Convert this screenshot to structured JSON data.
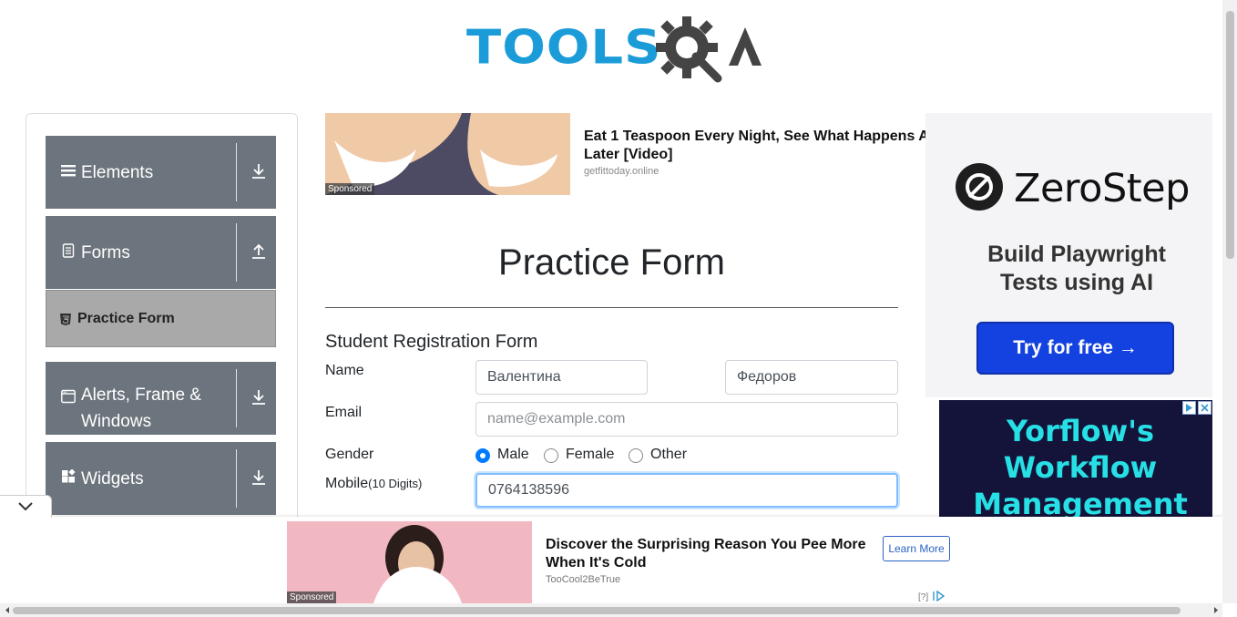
{
  "header": {
    "logo_text": "TOOLS",
    "logo_suffix": "QA"
  },
  "sidebar": {
    "groups": [
      {
        "label": "Elements",
        "icon": "hamburger-icon",
        "arrow": "download-icon"
      },
      {
        "label": "Forms",
        "icon": "document-icon",
        "arrow": "upload-icon"
      },
      {
        "label": "Alerts, Frame & Windows",
        "icon": "window-icon",
        "arrow": "download-icon"
      },
      {
        "label": "Widgets",
        "icon": "widgets-icon",
        "arrow": "download-icon"
      }
    ],
    "active_item": {
      "label": "Practice Form",
      "icon": "html5-icon"
    }
  },
  "ad_top": {
    "title": "Eat 1 Teaspoon Every Night, See What Happens A",
    "title_line2": "Later [Video]",
    "domain": "getfittoday.online",
    "sponsored": "Sponsored"
  },
  "main": {
    "title": "Practice Form",
    "form_title": "Student Registration Form"
  },
  "form": {
    "name_label": "Name",
    "first_name_value": "Валентина",
    "last_name_value": "Федоров",
    "email_label": "Email",
    "email_placeholder": "name@example.com",
    "gender_label": "Gender",
    "gender_options": [
      "Male",
      "Female",
      "Other"
    ],
    "gender_selected": "Male",
    "mobile_label": "Mobile",
    "mobile_hint": "(10 Digits)",
    "mobile_value": "0764138596"
  },
  "ad_right": {
    "brand": "ZeroStep",
    "tagline_1": "Build Playwright",
    "tagline_2": "Tests using AI",
    "cta": "Try for free →"
  },
  "ad_yorflow": {
    "line1": "Yorflow's",
    "line2": "Workflow",
    "line3": "Management"
  },
  "ad_bottom": {
    "title": "Discover the Surprising Reason You Pee More When It's Cold",
    "domain": "TooCool2BeTrue",
    "sponsored": "Sponsored",
    "cta": "Learn More",
    "info": "[?]"
  },
  "colors": {
    "logo_blue": "#1b9cd8",
    "logo_gray": "#444444",
    "sidebar_bg": "#6c757d",
    "active_item_bg": "#a9a9a9",
    "radio_accent": "#007bff",
    "zerostep_button": "#1442e0",
    "yorflow_text": "#27e0e6"
  }
}
